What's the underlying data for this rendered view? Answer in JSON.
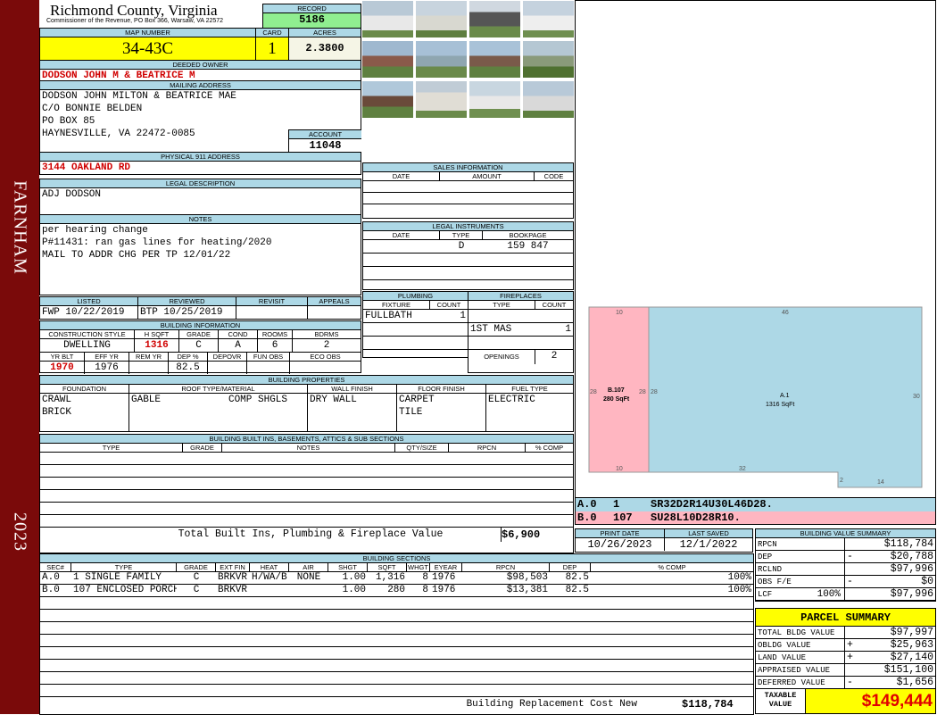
{
  "side": {
    "district": "FARNHAM",
    "year": "2023"
  },
  "header": {
    "county": "Richmond County, Virginia",
    "subtitle": "Commissioner of the Revenue, PO Box 366, Warsaw, VA 22572",
    "record_label": "RECORD",
    "record": "5186"
  },
  "parcel": {
    "map_label": "MAP NUMBER",
    "map": "34-43C",
    "card_label": "CARD",
    "card": "1",
    "acres_label": "ACRES",
    "acres": "2.3800"
  },
  "owner": {
    "label": "DEEDED OWNER",
    "name": "DODSON JOHN M & BEATRICE M"
  },
  "mailing": {
    "label": "MAILING ADDRESS",
    "lines": [
      "DODSON JOHN MILTON & BEATRICE MAE",
      "C/O BONNIE BELDEN",
      "PO BOX 85",
      "HAYNESVILLE, VA 22472-0085"
    ],
    "account_label": "ACCOUNT",
    "account": "11048"
  },
  "physical": {
    "label": "PHYSICAL 911 ADDRESS",
    "address": "3144 OAKLAND RD"
  },
  "legal": {
    "label": "LEGAL DESCRIPTION",
    "text": "ADJ DODSON"
  },
  "notes": {
    "label": "NOTES",
    "lines": [
      "per hearing change",
      "P#11431: ran gas lines for heating/2020",
      "MAIL TO ADDR CHG PER TP 12/01/22"
    ]
  },
  "review": {
    "headers": [
      "LISTED",
      "REVIEWED",
      "REVISIT",
      "APPEALS"
    ],
    "listed": "FWP 10/22/2019",
    "reviewed": "BTP 10/25/2019",
    "revisit": "",
    "appeals": ""
  },
  "building_info": {
    "label": "BUILDING INFORMATION",
    "h1": [
      "CONSTRUCTION STYLE",
      "H SQFT",
      "GRADE",
      "COND",
      "ROOMS",
      "BDRMS"
    ],
    "v1": [
      "DWELLING",
      "1316",
      "C",
      "A",
      "6",
      "2"
    ],
    "h2": [
      "YR BLT",
      "EFF YR",
      "REM YR",
      "DEP %",
      "DEPOVR",
      "FUN OBS",
      "ECO OBS"
    ],
    "v2": [
      "1970",
      "1976",
      "",
      "82.5",
      "",
      "",
      ""
    ]
  },
  "sales": {
    "label": "SALES INFORMATION",
    "headers": [
      "DATE",
      "AMOUNT",
      "CODE"
    ]
  },
  "instruments": {
    "label": "LEGAL INSTRUMENTS",
    "headers": [
      "DATE",
      "TYPE",
      "BOOKPAGE"
    ],
    "rows": [
      [
        "",
        "D",
        "159 847"
      ]
    ]
  },
  "plumbing": {
    "label": "PLUMBING",
    "headers": [
      "FIXTURE",
      "COUNT"
    ],
    "rows": [
      [
        "FULLBATH",
        "1"
      ]
    ]
  },
  "fireplaces": {
    "label": "FIREPLACES",
    "headers": [
      "TYPE",
      "COUNT"
    ],
    "rows": [
      [
        "1ST MAS",
        "1"
      ]
    ],
    "openings_label": "OPENINGS",
    "openings": "2"
  },
  "properties": {
    "label": "BUILDING PROPERTIES",
    "headers": [
      "FOUNDATION",
      "ROOF TYPE/MATERIAL",
      "WALL FINISH",
      "FLOOR FINISH",
      "FUEL TYPE"
    ],
    "foundation": [
      "CRAWL",
      "BRICK"
    ],
    "roof_type": "GABLE",
    "roof_material": "COMP SHGLS",
    "wall": "DRY WALL",
    "floor": [
      "CARPET",
      "TILE"
    ],
    "fuel": "ELECTRIC"
  },
  "builtins": {
    "label": "BUILDING BUILT INS, BASEMENTS, ATTICS & SUB SECTIONS",
    "headers": [
      "TYPE",
      "GRADE",
      "NOTES",
      "QTY/SIZE",
      "RPCN",
      "% COMP"
    ],
    "total_label": "Total Built Ins, Plumbing & Fireplace Value",
    "total": "$6,900"
  },
  "dates": {
    "print_label": "PRINT DATE",
    "print": "10/26/2023",
    "saved_label": "LAST SAVED",
    "saved": "12/1/2022"
  },
  "sections": {
    "label": "BUILDING SECTIONS",
    "headers": [
      "SEC#",
      "TYPE",
      "GRADE",
      "EXT FIN",
      "HEAT",
      "AIR",
      "SHGT",
      "SQFT",
      "WHGT",
      "EYEAR",
      "RPCN",
      "DEP",
      "% COMP"
    ],
    "rows": [
      [
        "A.0",
        "1 SINGLE FAMILY",
        "C",
        "BRKVR",
        "H/WA/B",
        "NONE",
        "1.00",
        "1,316",
        "8",
        "1976",
        "$98,503",
        "82.5",
        "100%"
      ],
      [
        "B.0",
        "107 ENCLOSED PORCH",
        "C",
        "BRKVR",
        "",
        "",
        "1.00",
        "280",
        "8",
        "1976",
        "$13,381",
        "82.5",
        "100%"
      ]
    ],
    "rcn_label": "Building Replacement Cost New",
    "rcn": "$118,784"
  },
  "sketch": {
    "a_label": "A.1",
    "a_area": "1316 SqFt",
    "b_label": "B.107",
    "b_area": "280 SqFt",
    "dims": {
      "top_a": "46",
      "top_b": "10",
      "left_b": "28",
      "mid_l": "28",
      "right": "30",
      "bottom_b": "10",
      "bottom_a": "32",
      "notch": "2",
      "bottom_r": "14"
    },
    "vectors": [
      {
        "sec": "A.0",
        "code": "1",
        "vector": "SR32D2R14U30L46D28."
      },
      {
        "sec": "B.0",
        "code": "107",
        "vector": "SU28L10D28R10."
      }
    ]
  },
  "value_summary": {
    "label": "BUILDING VALUE SUMMARY",
    "rows": [
      {
        "label": "RPCN",
        "sign": "",
        "value": "$118,784"
      },
      {
        "label": "DEP",
        "sign": "-",
        "value": "$20,788"
      },
      {
        "label": "RCLND",
        "sign": "",
        "value": "$97,996"
      },
      {
        "label": "OBS F/E",
        "sign": "-",
        "value": "$0"
      },
      {
        "label": "LCF",
        "pct": "100%",
        "sign": "",
        "value": "$97,996"
      }
    ]
  },
  "parcel_summary": {
    "title": "PARCEL SUMMARY",
    "rows": [
      {
        "label": "TOTAL BLDG VALUE",
        "sign": "",
        "value": "$97,997"
      },
      {
        "label": "OBLDG VALUE",
        "sign": "+",
        "value": "$25,963"
      },
      {
        "label": "LAND VALUE",
        "sign": "+",
        "value": "$27,140"
      },
      {
        "label": "APPRAISED VALUE",
        "sign": "",
        "value": "$151,100"
      },
      {
        "label": "DEFERRED VALUE",
        "sign": "-",
        "value": "$1,656"
      }
    ],
    "taxable_label": "TAXABLE VALUE",
    "taxable": "$149,444"
  },
  "colors": {
    "header": "#add8e6",
    "yellow": "#ffff00",
    "record": "#90ee90",
    "side": "#7a0a0a",
    "red": "#d00000",
    "pink": "#ffb6c1"
  }
}
